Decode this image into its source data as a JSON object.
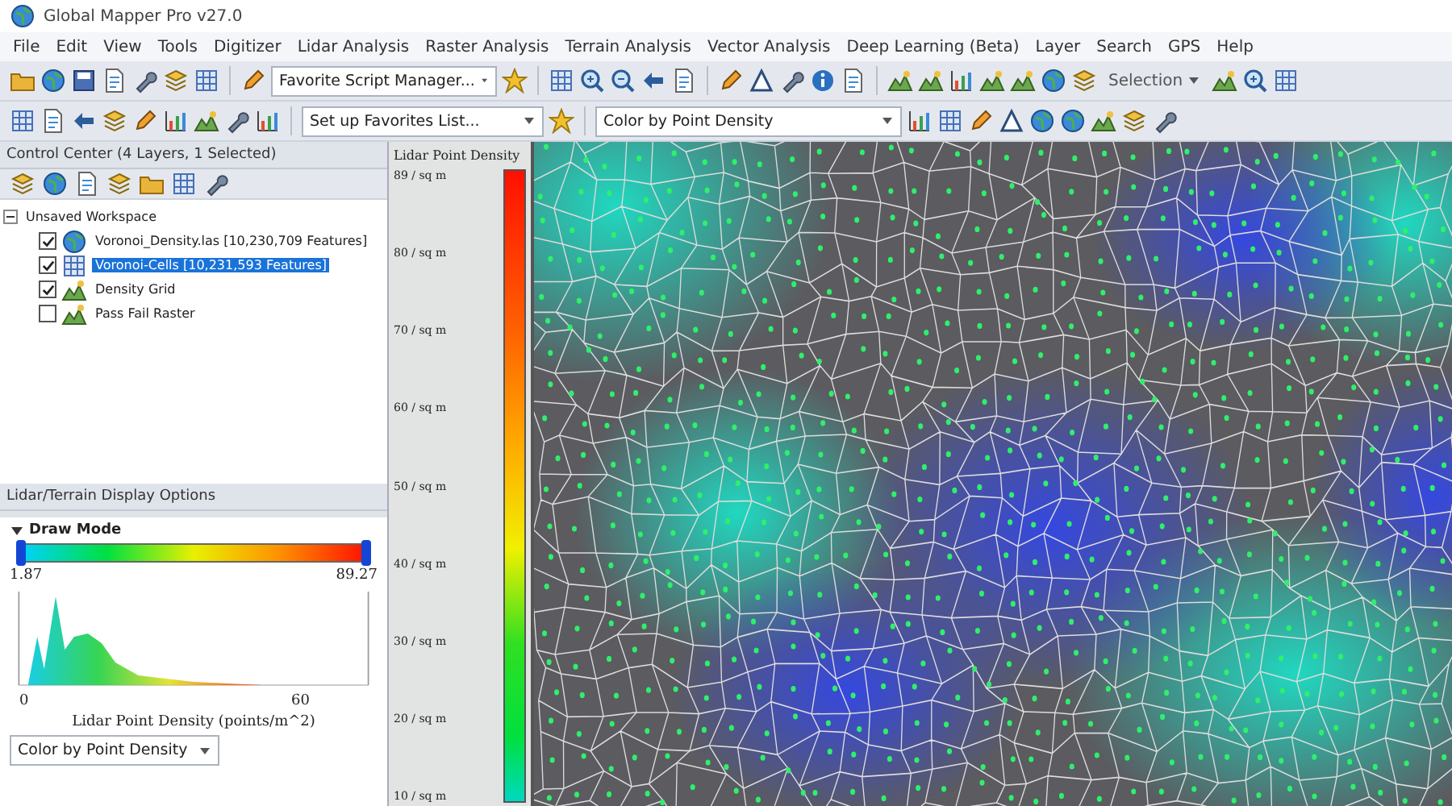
{
  "window": {
    "title": "Global Mapper Pro v27.0"
  },
  "menu": [
    "File",
    "Edit",
    "View",
    "Tools",
    "Digitizer",
    "Lidar Analysis",
    "Raster Analysis",
    "Terrain Analysis",
    "Vector Analysis",
    "Deep Learning (Beta)",
    "Layer",
    "Search",
    "GPS",
    "Help"
  ],
  "toolbar": {
    "script_combo": "Favorite Script Manager...",
    "favorites_combo": "Set up Favorites List...",
    "color_combo": "Color by Point Density",
    "selection_menu": "Selection"
  },
  "control_center": {
    "title": "Control Center (4 Layers, 1 Selected)",
    "workspace": {
      "label": "Unsaved Workspace",
      "expanded": true,
      "children": [
        {
          "label": "Voronoi_Density.las [10,230,709 Features]",
          "checked": true,
          "selected": false
        },
        {
          "label": "Voronoi-Cells [10,231,593 Features]",
          "checked": true,
          "selected": true
        },
        {
          "label": "Density Grid",
          "checked": true,
          "selected": false
        },
        {
          "label": "Pass Fail Raster",
          "checked": false,
          "selected": false
        }
      ]
    }
  },
  "display_options": {
    "title": "Lidar/Terrain Display Options",
    "section": "Draw Mode",
    "expanded": true,
    "handles": [
      {
        "level": 0
      },
      {
        "level": 1
      }
    ],
    "range_min": "1.87",
    "range_max": "89.27",
    "histogram_ticks": [
      "0",
      "60"
    ],
    "histogram_label": "Lidar Point Density (points/m^2)",
    "color_mode": "Color by Point Density"
  },
  "legend": {
    "title": "Lidar Point Density",
    "labels": [
      "89 / sq m",
      "80 / sq m",
      "70 / sq m",
      "60 / sq m",
      "50 / sq m",
      "40 / sq m",
      "30 / sq m",
      "20 / sq m",
      "10 / sq m"
    ]
  }
}
